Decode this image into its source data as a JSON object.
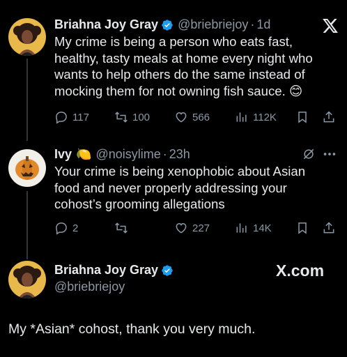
{
  "tweet1": {
    "name": "Briahna Joy Gray",
    "handle": "@briebriejoy",
    "separator": "·",
    "time": "1d",
    "lines": [
      "My crime is being a person who eats fast,",
      "healthy, tasty meals at home every night who",
      "wants to help others do the same instead of",
      "mocking them for not owning fish sauce. 😊"
    ],
    "replies": "117",
    "reposts": "100",
    "likes": "566",
    "views": "112K"
  },
  "tweet2": {
    "name": "Ivy",
    "name_emoji": "🍋",
    "handle": "@noisylime",
    "separator": "·",
    "time": "23h",
    "lines": [
      "Your crime is being xenophobic about Asian",
      "food and never properly addressing your",
      "cohost’s grooming allegations"
    ],
    "replies": "2",
    "reposts": "",
    "likes": "227",
    "views": "14K"
  },
  "tweet3": {
    "name": "Briahna Joy Gray",
    "handle": "@briebriejoy",
    "text": "My *Asian* cohost, thank you very much.",
    "brand": "X.com"
  },
  "colors": {
    "background": "#000000",
    "text": "#e7e9ea",
    "muted": "#8b98a5",
    "verified": "#1d9bf0"
  }
}
